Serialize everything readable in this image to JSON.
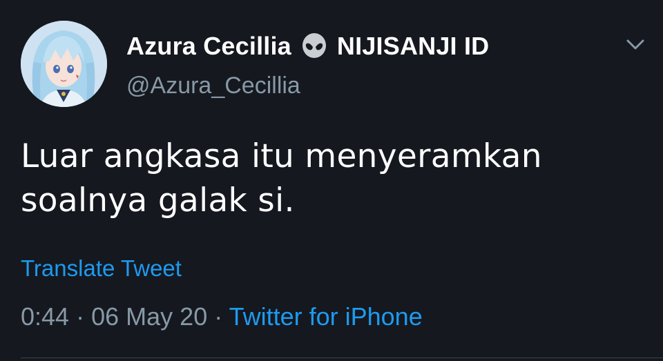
{
  "tweet": {
    "display_name": "Azura Cecillia",
    "badge_icon": "alien-icon",
    "badge_text": "NIJISANJI ID",
    "handle": "@Azura_Cecillia",
    "text_line1": "Luar angkasa itu menyeramkan",
    "text_line2": "soalnya galak si.",
    "translate_label": "Translate Tweet",
    "time": "0:44",
    "separator": "·",
    "date": "06 May 20",
    "source": "Twitter for iPhone",
    "menu_icon": "chevron-down-icon"
  },
  "colors": {
    "background": "#15181f",
    "text": "#ffffff",
    "secondary": "#8899a6",
    "link": "#1d9bf0",
    "divider": "#38444d"
  }
}
